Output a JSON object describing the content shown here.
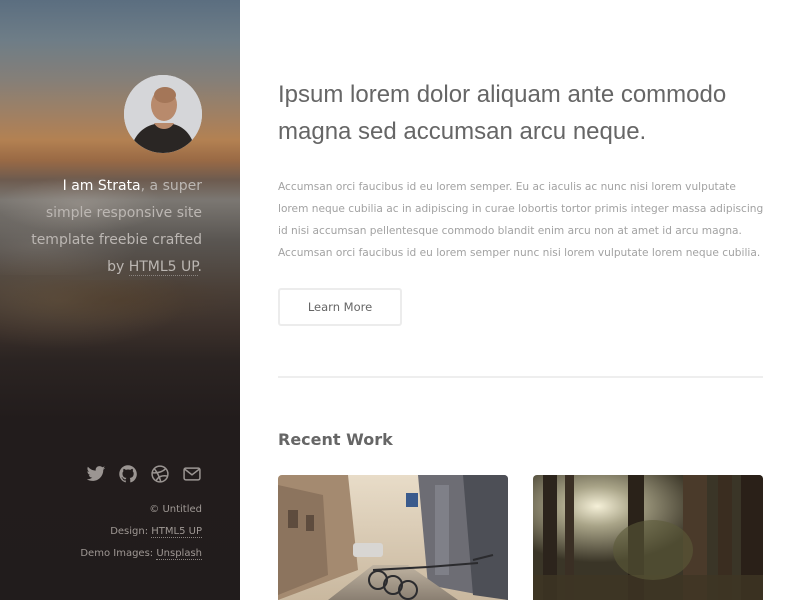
{
  "sidebar": {
    "intro": {
      "name": "I am Strata",
      "rest": ", a super simple responsive site template freebie crafted by ",
      "link": "HTML5 UP",
      "end": "."
    },
    "social_icons": [
      "twitter-icon",
      "github-icon",
      "dribbble-icon",
      "envelope-icon"
    ],
    "credits": {
      "copyright": "© Untitled",
      "design_label": "Design: ",
      "design_link": "HTML5 UP",
      "images_label": "Demo Images: ",
      "images_link": "Unsplash"
    }
  },
  "main": {
    "headline": "Ipsum lorem dolor aliquam ante commodo magna sed accumsan arcu neque.",
    "body": "Accumsan orci faucibus id eu lorem semper. Eu ac iaculis ac nunc nisi lorem vulputate lorem neque cubilia ac in adipiscing in curae lobortis tortor primis integer massa adipiscing id nisi accumsan pellentesque commodo blandit enim arcu non at amet id arcu magna. Accumsan orci faucibus id eu lorem semper nunc nisi lorem vulputate lorem neque cubilia.",
    "button_label": "Learn More",
    "section_title": "Recent Work"
  },
  "colors": {
    "sidebar_bg": "#211c1c",
    "heading_text": "#666666",
    "body_text": "#a2a2a2",
    "button_border": "#ececec"
  }
}
